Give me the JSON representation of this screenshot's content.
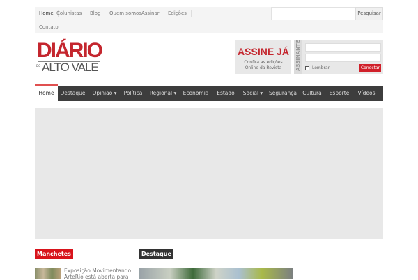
{
  "topnav": {
    "items": [
      "Home",
      "Colunistas",
      "Blog",
      "Quem somos",
      "Assinar",
      "Edições",
      "Contato"
    ]
  },
  "search": {
    "placeholder": "",
    "button": "Pesquisar"
  },
  "logo": {
    "line1": "DIÁRIO",
    "small": "DO",
    "line2": "ALTO VALE"
  },
  "promo": {
    "title": "ASSINE JÁ",
    "line1": "Confira as edições",
    "line2": "Online da Revista"
  },
  "login": {
    "label": "ASSINANTE",
    "remember": "Lembrar",
    "button": "Conectar"
  },
  "mainnav": {
    "items": [
      "Home",
      "Destaque",
      "Opinião ▾",
      "Política",
      "Regional ▾",
      "Economia",
      "Estado",
      "Social ▾",
      "Segurança",
      "Cultura",
      "Esporte",
      "Vídeos"
    ]
  },
  "sections": {
    "manchetes": "Manchetes",
    "destaque": "Destaque"
  },
  "news": [
    {
      "title": "Exposição Movimentando ArteRio está aberta para"
    }
  ],
  "colors": {
    "brand": "#c4262e",
    "nav": "#3d3d3d"
  }
}
